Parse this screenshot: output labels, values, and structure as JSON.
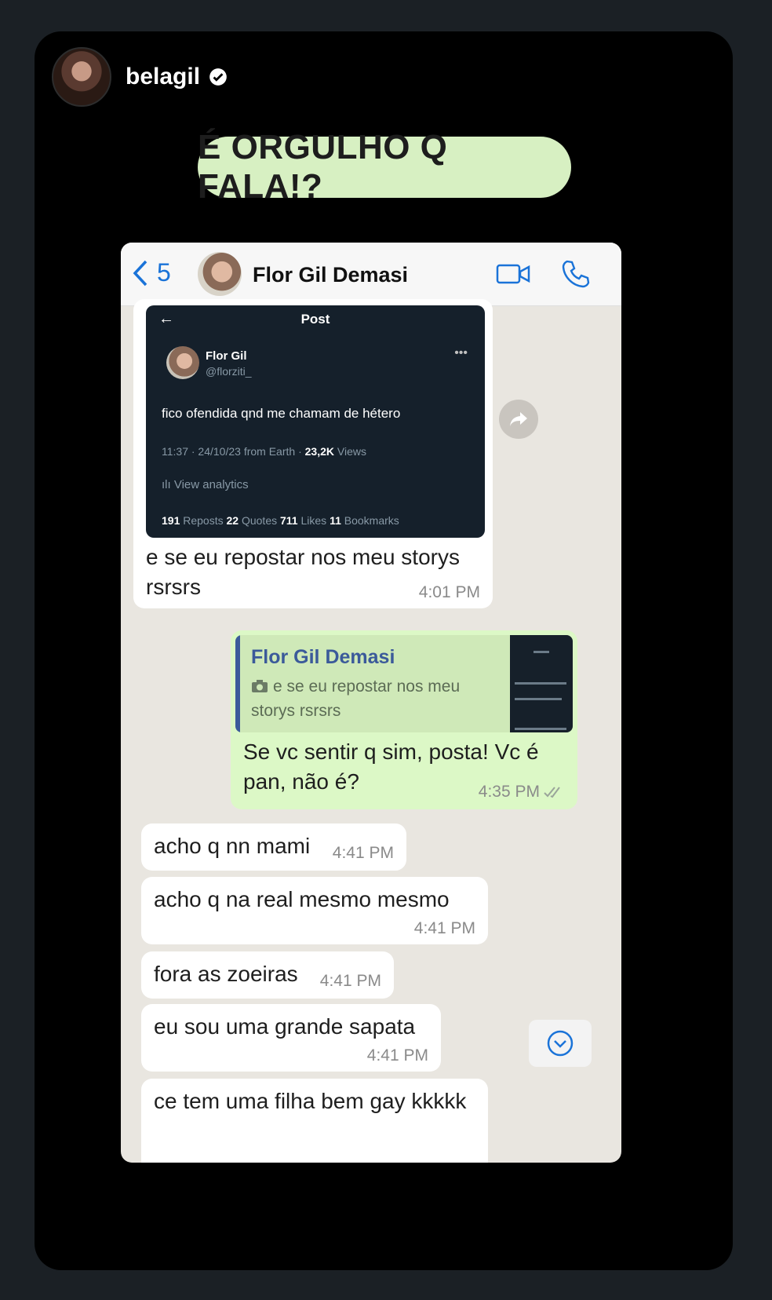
{
  "story": {
    "username": "belagil",
    "sticker_text": "É ORGULHO Q FALA!?"
  },
  "chat": {
    "header": {
      "back_count": "5",
      "contact_name": "Flor Gil Demasi"
    },
    "tweet": {
      "header": "Post",
      "name": "Flor Gil",
      "handle": "@florziti_",
      "text": "fico ofendida qnd me chamam de hétero",
      "meta": "11:37 · 24/10/23 from Earth · ",
      "views": "23,2K",
      "views_label": " Views",
      "analytics": "View analytics",
      "reposts": "191",
      "reposts_label": " Reposts  ",
      "quotes": "22",
      "quotes_label": " Quotes  ",
      "likes": "711",
      "likes_label": " Likes  ",
      "bookmarks": "11",
      "bookmarks_label": " Bookmarks"
    },
    "messages": [
      {
        "text": "e se eu repostar nos meu storys rsrsrs",
        "time": "4:01 PM"
      },
      {
        "quote_name": "Flor Gil Demasi",
        "quote_text": "e se eu repostar nos meu storys rsrsrs",
        "text": "Se vc sentir q sim, posta! Vc é pan, não é?",
        "time": "4:35 PM"
      },
      {
        "text": "acho q nn mami",
        "time": "4:41 PM"
      },
      {
        "text": "acho q na real mesmo mesmo",
        "time": "4:41 PM"
      },
      {
        "text": "fora as zoeiras",
        "time": "4:41 PM"
      },
      {
        "text": "eu sou uma grande sapata",
        "time": "4:41 PM"
      },
      {
        "text": "ce tem uma filha bem gay kkkkk",
        "time": ""
      }
    ]
  }
}
